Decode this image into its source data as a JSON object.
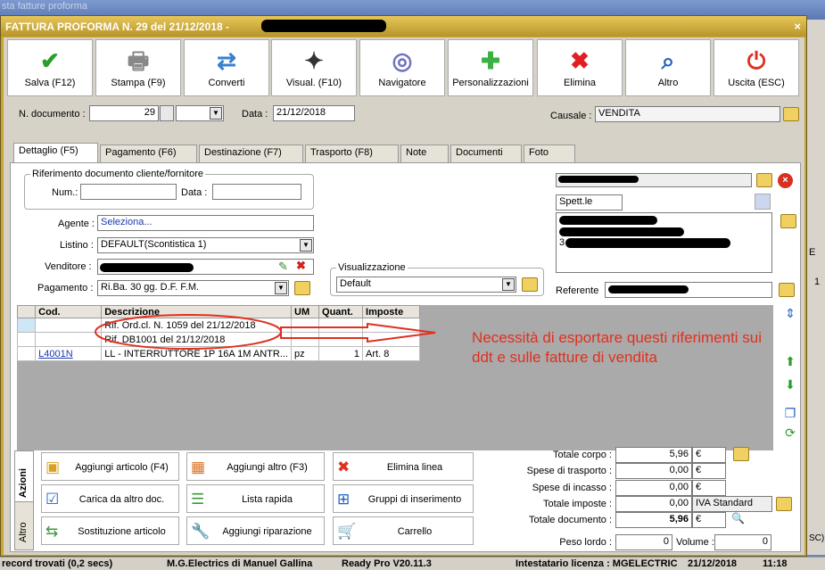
{
  "window": {
    "title": "FATTURA PROFORMA N. 29 del 21/12/2018 -",
    "close": "×"
  },
  "toolbar": [
    {
      "label": "Salva (F12)",
      "icon": "check-icon",
      "color": "#2a9d2a"
    },
    {
      "label": "Stampa (F9)",
      "icon": "printer-icon",
      "color": "#888888"
    },
    {
      "label": "Converti",
      "icon": "convert-icon",
      "color": "#3a7fd0"
    },
    {
      "label": "Visual. (F10)",
      "icon": "magic-wand-icon",
      "color": "#333333"
    },
    {
      "label": "Navigatore",
      "icon": "compass-icon",
      "color": "#7070c0"
    },
    {
      "label": "Personalizzazioni",
      "icon": "puzzle-icon",
      "color": "#3cb043"
    },
    {
      "label": "Elimina",
      "icon": "delete-x-icon",
      "color": "#e02020"
    },
    {
      "label": "Altro",
      "icon": "search-icon",
      "color": "#2060c0"
    },
    {
      "label": "Uscita (ESC)",
      "icon": "power-icon",
      "color": "#e03020"
    }
  ],
  "header": {
    "ndoc_label": "N. documento :",
    "ndoc_value": "29",
    "data_label": "Data :",
    "data_value": "21/12/2018",
    "causale_label": "Causale :",
    "causale_value": "VENDITA"
  },
  "tabs": [
    "Dettaglio (F5)",
    "Pagamento (F6)",
    "Destinazione (F7)",
    "Trasporto (F8)",
    "Note",
    "Documenti",
    "Foto"
  ],
  "dettaglio": {
    "rif_group": "Riferimento documento cliente/fornitore",
    "num_label": "Num.:",
    "data_label": "Data :",
    "agente_label": "Agente :",
    "agente_value": "Seleziona...",
    "listino_label": "Listino :",
    "listino_value": "DEFAULT(Scontistica 1)",
    "venditore_label": "Venditore :",
    "pagamento_label": "Pagamento :",
    "pagamento_value": "Ri.Ba. 30 gg. D.F. F.M.",
    "visual_group": "Visualizzazione",
    "visual_value": "Default",
    "spett": "Spett.le",
    "addr_digit": "3",
    "referente_label": "Referente"
  },
  "grid": {
    "columns": [
      "Cod.",
      "Descrizione",
      "UM",
      "Quant.",
      "Imposte"
    ],
    "rows": [
      [
        "",
        "Rif. Ord.cl. N. 1059 del 21/12/2018",
        "",
        "",
        ""
      ],
      [
        "",
        "Rif. DB1001 del 21/12/2018",
        "",
        "",
        ""
      ],
      [
        "L4001N",
        "LL - INTERRUTTORE 1P 16A 1M ANTR...",
        "pz",
        "1",
        "Art. 8"
      ]
    ]
  },
  "annotation": "Necessità di esportare questi riferimenti sui ddt e sulle fatture di vendita",
  "side_tabs": [
    "Azioni",
    "Altro"
  ],
  "actions": [
    {
      "label": "Aggiungi articolo (F4)",
      "icon": "add-item-icon"
    },
    {
      "label": "Aggiungi altro (F3)",
      "icon": "add-other-icon"
    },
    {
      "label": "Elimina linea",
      "icon": "delete-line-icon"
    },
    {
      "label": "Carica da altro doc.",
      "icon": "load-doc-icon"
    },
    {
      "label": "Lista rapida",
      "icon": "quick-list-icon"
    },
    {
      "label": "Gruppi di inserimento",
      "icon": "insert-group-icon"
    },
    {
      "label": "Sostituzione articolo",
      "icon": "replace-item-icon"
    },
    {
      "label": "Aggiungi riparazione",
      "icon": "wrench-icon"
    },
    {
      "label": "Carrello",
      "icon": "cart-icon"
    }
  ],
  "totals": {
    "corpo_label": "Totale corpo :",
    "corpo_value": "5,96",
    "euro": "€",
    "trasporto_label": "Spese di trasporto :",
    "trasporto_value": "0,00",
    "incasso_label": "Spese di incasso :",
    "incasso_value": "0,00",
    "imposte_label": "Totale imposte :",
    "imposte_value": "0,00",
    "iva": "IVA Standard",
    "documento_label": "Totale documento :",
    "documento_value": "5,96",
    "peso_label": "Peso lordo :",
    "peso_value": "0",
    "volume_label": "Volume :",
    "volume_value": "0"
  },
  "statusbar": {
    "records": "record trovati (0,2 secs)",
    "company": "M.G.Electrics di Manuel Gallina",
    "version": "Ready Pro V20.11.3",
    "license": "Intestatario licenza : MGELECTRIC",
    "date": "21/12/2018",
    "time": "11:18"
  },
  "background": {
    "top_text": "sta fatture proforma",
    "right_col": "E",
    "right_one": "1",
    "right_sc": "SC)"
  }
}
